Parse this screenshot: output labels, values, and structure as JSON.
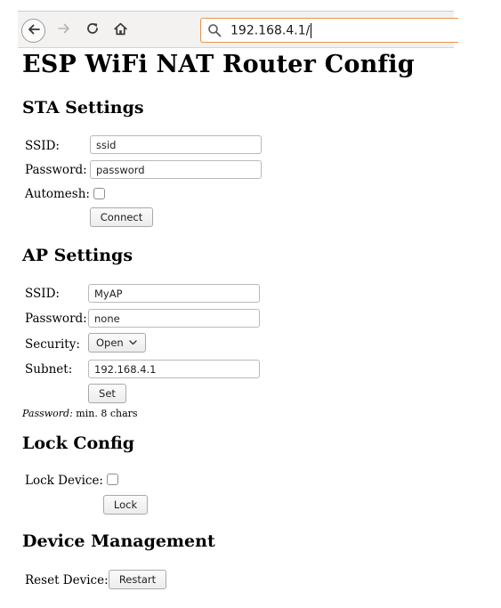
{
  "browser": {
    "url": "192.168.4.1/",
    "icons": {
      "back": "arrow-left-icon",
      "forward": "arrow-right-icon",
      "reload": "reload-icon",
      "home": "home-icon",
      "search": "search-icon"
    },
    "accent_color": "#e9944a"
  },
  "page": {
    "title": "ESP WiFi NAT Router Config"
  },
  "sta": {
    "heading": "STA Settings",
    "ssid_label": "SSID:",
    "ssid_value": "ssid",
    "password_label": "Password:",
    "password_value": "password",
    "automesh_label": "Automesh:",
    "automesh_checked": false,
    "connect_label": "Connect"
  },
  "ap": {
    "heading": "AP Settings",
    "ssid_label": "SSID:",
    "ssid_value": "MyAP",
    "password_label": "Password:",
    "password_value": "none",
    "security_label": "Security:",
    "security_value": "Open",
    "subnet_label": "Subnet:",
    "subnet_value": "192.168.4.1",
    "set_label": "Set",
    "note_label": "Password:",
    "note_text": " min. 8 chars"
  },
  "lock": {
    "heading": "Lock Config",
    "lock_device_label": "Lock Device:",
    "lock_checked": false,
    "lock_button_label": "Lock"
  },
  "device": {
    "heading": "Device Management",
    "reset_label": "Reset Device:",
    "restart_label": "Restart"
  }
}
